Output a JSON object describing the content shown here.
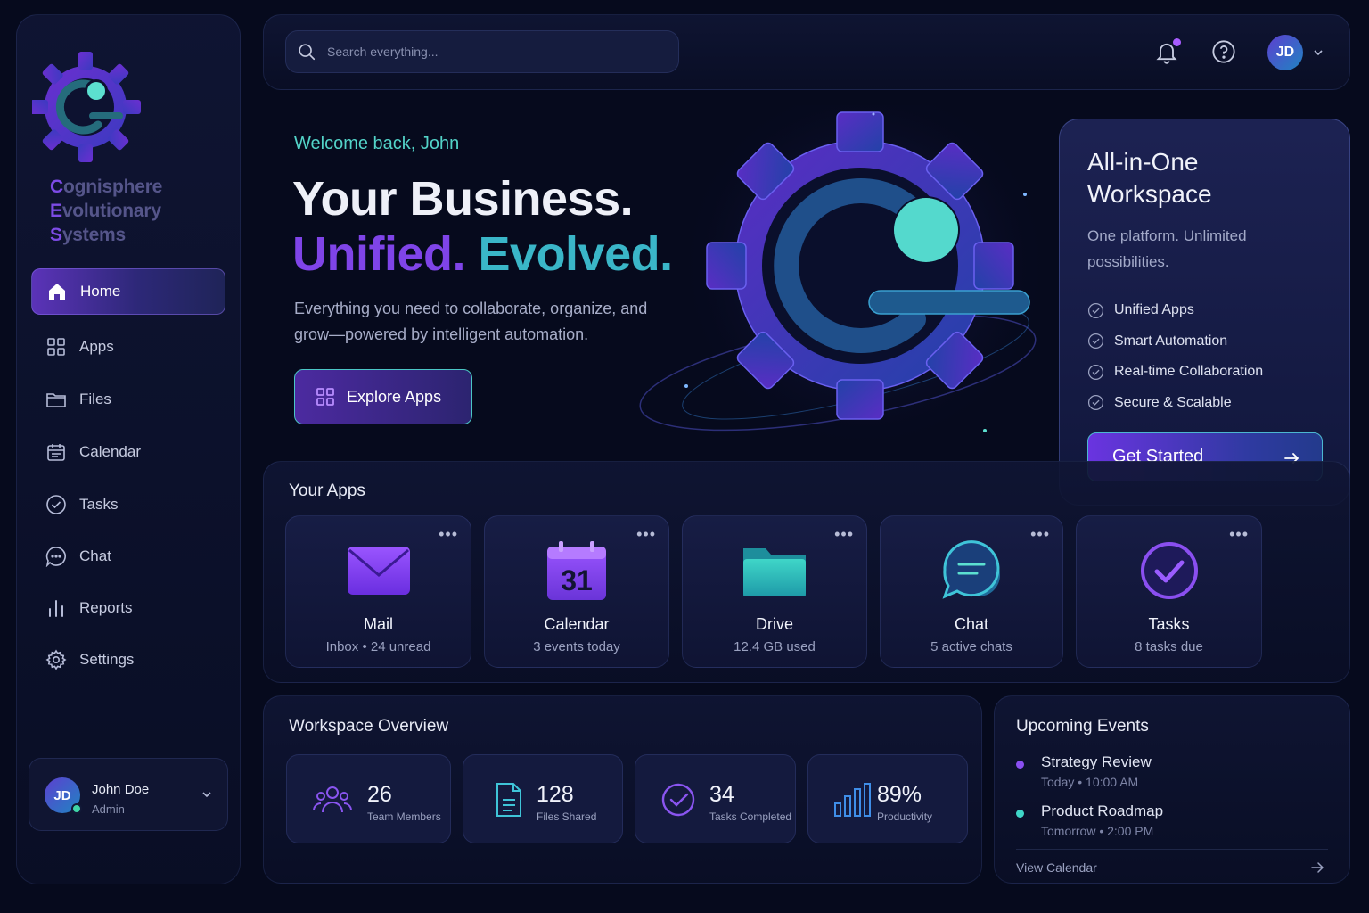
{
  "brand": {
    "line1": "Cognisphere",
    "line2": "Evolutionary",
    "line3": "Systems"
  },
  "sidebar": {
    "items": [
      {
        "label": "Home",
        "icon": "home-icon"
      },
      {
        "label": "Apps",
        "icon": "grid-icon"
      },
      {
        "label": "Files",
        "icon": "folder-icon"
      },
      {
        "label": "Calendar",
        "icon": "calendar-icon"
      },
      {
        "label": "Tasks",
        "icon": "check-circle-icon"
      },
      {
        "label": "Chat",
        "icon": "chat-icon"
      },
      {
        "label": "Reports",
        "icon": "bar-chart-icon"
      },
      {
        "label": "Settings",
        "icon": "gear-icon"
      }
    ],
    "active": "Home"
  },
  "user": {
    "initials": "JD",
    "name": "John Doe",
    "role": "Admin"
  },
  "search": {
    "placeholder": "Search everything..."
  },
  "hero": {
    "welcome": "Welcome back, John",
    "title": "Your Business.",
    "subtitle_1": "Unified.",
    "subtitle_2": "Evolved.",
    "description": "Everything you need to collaborate, organize, and grow—powered by intelligent automation.",
    "cta": "Explore Apps"
  },
  "feature_card": {
    "title": "All-in-One Workspace",
    "description": "One platform. Unlimited possibilities.",
    "items": [
      "Unified Apps",
      "Smart Automation",
      "Real-time Collaboration",
      "Secure & Scalable"
    ],
    "cta": "Get Started"
  },
  "apps": {
    "title": "Your Apps",
    "items": [
      {
        "name": "Mail",
        "meta": "Inbox • 24 unread",
        "icon": "mail-icon"
      },
      {
        "name": "Calendar",
        "meta": "3 events today",
        "icon": "calendar-icon",
        "date": "31"
      },
      {
        "name": "Drive",
        "meta": "12.4 GB used",
        "icon": "folder-icon"
      },
      {
        "name": "Chat",
        "meta": "5 active chats",
        "icon": "chat-icon"
      },
      {
        "name": "Tasks",
        "meta": "8 tasks due",
        "icon": "check-circle-icon"
      }
    ],
    "more_label": "•••"
  },
  "overview": {
    "title": "Workspace Overview",
    "stats": [
      {
        "value": "26",
        "label": "Team Members",
        "icon": "users-icon"
      },
      {
        "value": "128",
        "label": "Files Shared",
        "icon": "file-icon"
      },
      {
        "value": "34",
        "label": "Tasks Completed",
        "icon": "check-circle-icon"
      },
      {
        "value": "89%",
        "label": "Productivity",
        "icon": "bar-chart-icon"
      }
    ]
  },
  "events": {
    "title": "Upcoming Events",
    "items": [
      {
        "title": "Strategy Review",
        "time": "Today • 10:00 AM",
        "color": "#8a4ff0"
      },
      {
        "title": "Product Roadmap",
        "time": "Tomorrow • 2:00 PM",
        "color": "#3fd6c8"
      }
    ],
    "view_all": "View Calendar"
  },
  "colors": {
    "accent_purple": "#7f44e8",
    "accent_teal": "#3ab6c8",
    "background": "#060a1d"
  }
}
